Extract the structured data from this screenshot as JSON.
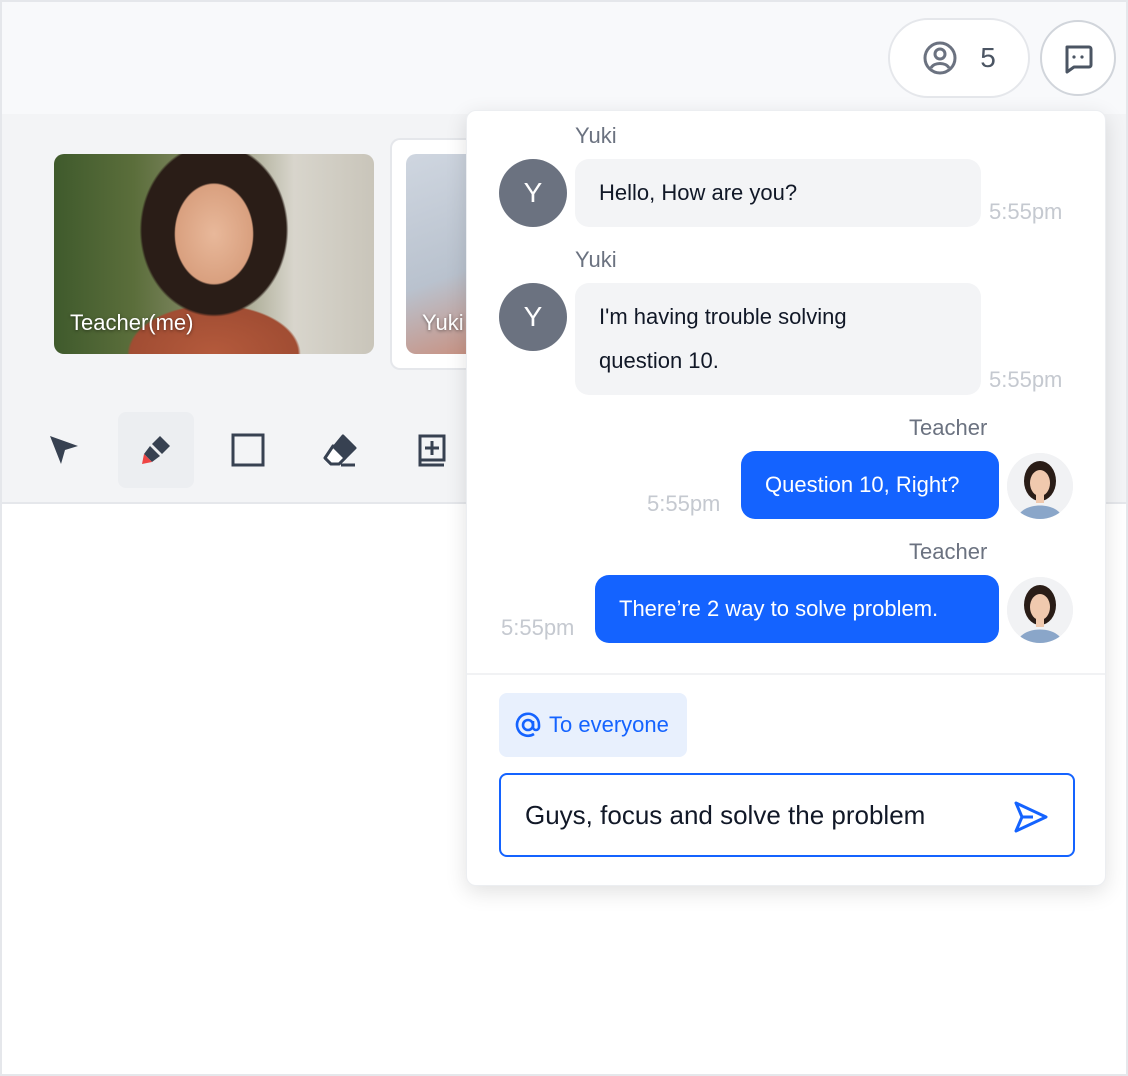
{
  "header": {
    "participant_count": "5"
  },
  "videos": [
    {
      "label": "Teacher(me)"
    },
    {
      "label": "Yuki"
    }
  ],
  "toolbar": {
    "tools": [
      "select-tool",
      "pen-tool",
      "rectangle-tool",
      "eraser-tool",
      "add-page-tool"
    ],
    "active_tool": "pen-tool"
  },
  "chat": {
    "messages": [
      {
        "sender": "Yuki",
        "avatar_initial": "Y",
        "text": "Hello, How are you?",
        "time": "5:55pm"
      },
      {
        "sender": "Yuki",
        "avatar_initial": "Y",
        "text_line1": "I'm having trouble solving",
        "text_line2": "question 10.",
        "time": "5:55pm"
      },
      {
        "sender": "Teacher",
        "text": "Question 10, Right?",
        "time": "5:55pm"
      },
      {
        "sender": "Teacher",
        "text": "There’re 2 way to solve problem.",
        "time": "5:55pm"
      }
    ],
    "recipient": "To everyone",
    "input_value": "Guys, focus and solve the problem"
  },
  "colors": {
    "accent": "#1463ff",
    "incoming_bubble": "#f3f4f6",
    "avatar_gray": "#6b7280"
  }
}
